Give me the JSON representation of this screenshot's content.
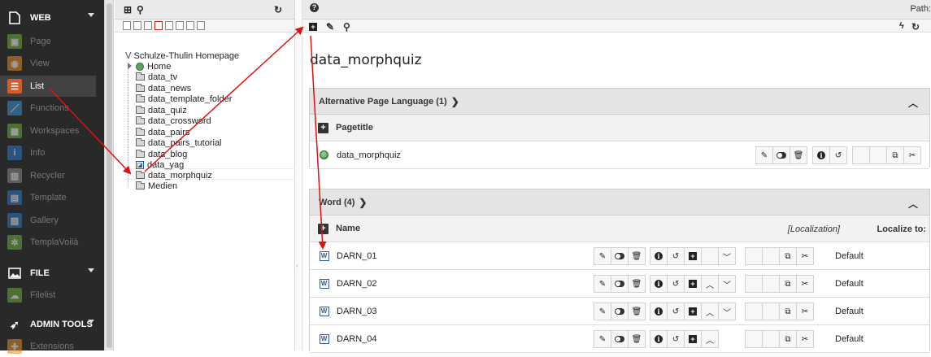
{
  "modmenu": {
    "groups": [
      {
        "label": "WEB"
      },
      {
        "label": "FILE"
      },
      {
        "label": "ADMIN TOOLS"
      }
    ],
    "web_items": [
      {
        "label": "Page",
        "color": "#6daa3f"
      },
      {
        "label": "View",
        "color": "#e38a25"
      },
      {
        "label": "List",
        "color": "#d35d2a"
      },
      {
        "label": "Functions",
        "color": "#3a8fd0"
      },
      {
        "label": "Workspaces",
        "color": "#6daa3f"
      },
      {
        "label": "Info",
        "color": "#2e78c2"
      },
      {
        "label": "Recycler",
        "color": "#888888"
      },
      {
        "label": "Template",
        "color": "#2e78c2"
      },
      {
        "label": "Gallery",
        "color": "#2e78c2"
      },
      {
        "label": "TemplaVoilà",
        "color": "#6daa3f"
      }
    ],
    "file_items": [
      {
        "label": "Filelist",
        "color": "#6daa3f"
      }
    ],
    "admin_items": [
      {
        "label": "Extensions",
        "color": "#e38a25"
      }
    ]
  },
  "tree": {
    "root": "Schulze-Thulin Homepage",
    "nodes": [
      {
        "label": "Home",
        "type": "home"
      },
      {
        "label": "data_tv",
        "type": "folder"
      },
      {
        "label": "data_news",
        "type": "folder"
      },
      {
        "label": "data_template_folder",
        "type": "folder"
      },
      {
        "label": "data_quiz",
        "type": "folder"
      },
      {
        "label": "data_crossword",
        "type": "folder"
      },
      {
        "label": "data_pairs",
        "type": "folder"
      },
      {
        "label": "data_pairs_tutorial",
        "type": "folder"
      },
      {
        "label": "data_blog",
        "type": "folder"
      },
      {
        "label": "data_yag",
        "type": "plugin"
      },
      {
        "label": "data_morphquiz",
        "type": "folder"
      },
      {
        "label": "Medien",
        "type": "folder"
      }
    ]
  },
  "content": {
    "path_label": "Path:",
    "title": "data_morphquiz",
    "alt_lang": {
      "heading": "Alternative Page Language (1)",
      "col_label": "Pagetitle",
      "row_name": "data_morphquiz"
    },
    "word": {
      "heading": "Word (4)",
      "col_label": "Name",
      "localization": "[Localization]",
      "localize_to": "Localize to:",
      "rows": [
        {
          "name": "DARN_01",
          "lang": "Default"
        },
        {
          "name": "DARN_02",
          "lang": "Default"
        },
        {
          "name": "DARN_03",
          "lang": "Default"
        },
        {
          "name": "DARN_04",
          "lang": "Default"
        }
      ]
    }
  },
  "colors": {
    "menu_bg": "#292929",
    "annotation_arrow": "#e01010"
  }
}
